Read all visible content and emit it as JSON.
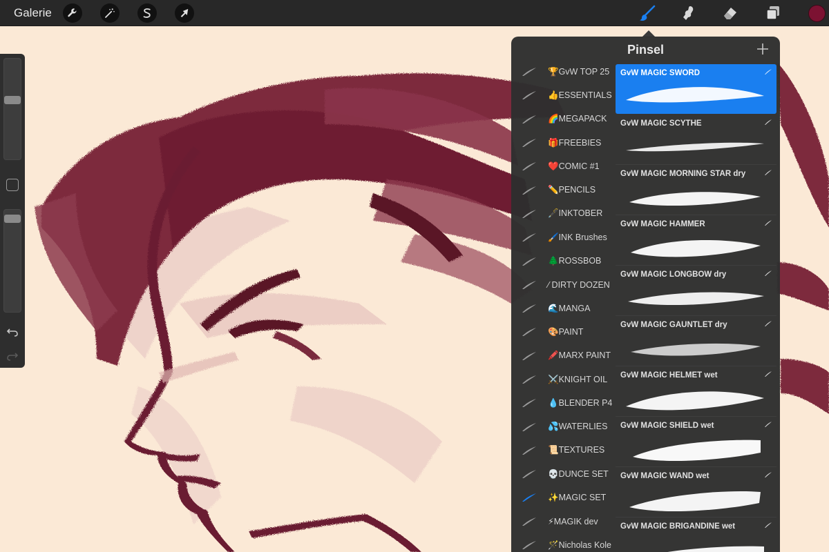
{
  "topbar": {
    "gallery_label": "Galerie",
    "left_tools": [
      {
        "name": "actions",
        "icon": "wrench-icon"
      },
      {
        "name": "adjustments",
        "icon": "magic-wand-icon"
      },
      {
        "name": "selection",
        "icon": "selection-s-icon"
      },
      {
        "name": "transform",
        "icon": "arrow-cursor-icon"
      }
    ],
    "right_tools": [
      {
        "name": "brush",
        "icon": "brush-icon",
        "active": true
      },
      {
        "name": "smudge",
        "icon": "smudge-icon"
      },
      {
        "name": "eraser",
        "icon": "eraser-icon"
      },
      {
        "name": "layers",
        "icon": "layers-icon"
      }
    ],
    "current_color": "#7c1232",
    "accent_color": "#1a7ff0"
  },
  "sidebar": {
    "brush_size_level": 0.6,
    "opacity_level": 0.05
  },
  "brush_panel": {
    "title": "Pinsel",
    "brush_sets": [
      {
        "label": "🏆GvW TOP 25"
      },
      {
        "label": "👍ESSENTIALS"
      },
      {
        "label": "🌈MEGAPACK"
      },
      {
        "label": "🎁FREEBIES"
      },
      {
        "label": "❤️COMIC #1"
      },
      {
        "label": "✏️PENCILS"
      },
      {
        "label": "🖋️INKTOBER"
      },
      {
        "label": "🖌️INK Brushes"
      },
      {
        "label": "🌲ROSSBOB"
      },
      {
        "label": "⁄ DIRTY DOZEN"
      },
      {
        "label": "🌊MANGA"
      },
      {
        "label": "🎨PAINT"
      },
      {
        "label": "🖍️MARX PAINT"
      },
      {
        "label": "⚔️KNIGHT OIL"
      },
      {
        "label": "💧BLENDER P4"
      },
      {
        "label": "💦WATERLIES"
      },
      {
        "label": "📜TEXTURES"
      },
      {
        "label": "💀DUNCE SET"
      },
      {
        "label": "✨MAGIC SET",
        "selected": true
      },
      {
        "label": "⚡MAGIK dev"
      },
      {
        "label": "🪄Nicholas Kole"
      }
    ],
    "brushes": [
      {
        "name": "GvW MAGIC SWORD",
        "selected": true
      },
      {
        "name": "GvW MAGIC SCYTHE"
      },
      {
        "name": "GvW MAGIC MORNING STAR dry"
      },
      {
        "name": "GvW MAGIC HAMMER"
      },
      {
        "name": "GvW MAGIC LONGBOW dry"
      },
      {
        "name": "GvW MAGIC GAUNTLET dry"
      },
      {
        "name": "GvW MAGIC HELMET wet"
      },
      {
        "name": "GvW MAGIC SHIELD wet"
      },
      {
        "name": "GvW MAGIC WAND wet"
      },
      {
        "name": "GvW MAGIC BRIGANDINE wet"
      }
    ]
  }
}
